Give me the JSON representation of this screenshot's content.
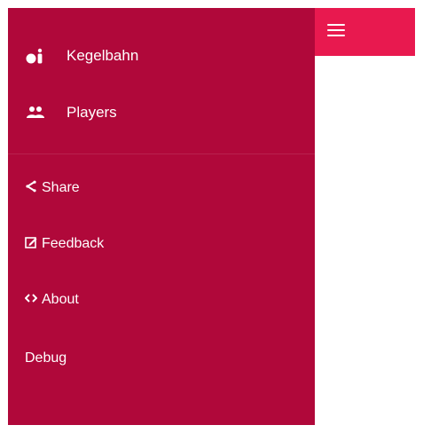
{
  "colors": {
    "drawer_bg": "#b0083a",
    "appbar_bg": "#e8194f",
    "text": "#ffffff"
  },
  "appbar": {
    "menu_icon": "hamburger-menu-icon"
  },
  "drawer": {
    "primary_items": [
      {
        "label": "Kegelbahn",
        "icon": "bowling-pins-icon"
      },
      {
        "label": "Players",
        "icon": "people-group-icon"
      }
    ],
    "secondary_items": [
      {
        "label": "Share",
        "icon": "share-icon"
      },
      {
        "label": "Feedback",
        "icon": "edit-icon"
      },
      {
        "label": "About",
        "icon": "code-brackets-icon"
      },
      {
        "label": "Debug",
        "icon": ""
      }
    ]
  }
}
